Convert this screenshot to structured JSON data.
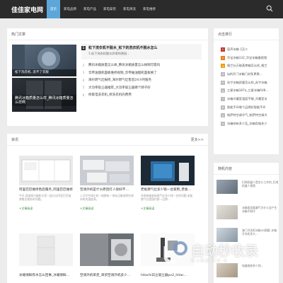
{
  "site": {
    "logo": "佳佳家电网"
  },
  "nav": {
    "items": [
      {
        "label": "首页",
        "active": true
      },
      {
        "label": "家电品牌"
      },
      {
        "label": "家电产品"
      },
      {
        "label": "家电安装"
      },
      {
        "label": "家电清洗"
      },
      {
        "label": "家电维修"
      }
    ]
  },
  "hot": {
    "title": "热门文章",
    "hero1_caption": "松下洗衣机..洗不了衣服",
    "hero2_caption": "腾讯冰箱质量怎么样_腾讯冰箱质量怎么样啊",
    "featured": {
      "num": "1",
      "title": "松下洗衣机不脱水_松下的洗衣机不脱水怎么",
      "desc": "1.松下洗衣机脱水异常的原因..."
    },
    "list": [
      {
        "num": "2",
        "text": "腾讯冰箱质量怎么样_腾讯冰箱质量怎么样啊可靠吗"
      },
      {
        "num": "3",
        "text": "华帝油烟机面板维修视频_华帝抽油烟机面板换了"
      },
      {
        "num": "4",
        "text": "海尔燃气灶报修_海尔燃气灶售后24小时服务"
      },
      {
        "num": "5",
        "text": "大功率吸尘器推荐_大功率吸尘器哪个牌子好"
      },
      {
        "num": "6",
        "text": "修家电洗衣机_修洗衣机的费用"
      }
    ]
  },
  "info": {
    "title": "资讯",
    "more": "更多>>",
    "cards": [
      {
        "title": "阿里巴巴维修售后服务_阿里巴巴维修",
        "desc": "今天,我很高兴能和大家一起讨论阿里巴巴维修售后服务的问题。",
        "tag": "+文章阅读"
      },
      {
        "title": "空调外机是什么原因打人很好不…",
        "desc": "1.打开空调主机一般都有一块标注着说明空调外机的温度表。",
        "tag": "+文章阅读"
      },
      {
        "title": "老板燃气灶多少钱一台家用_老板…",
        "desc": "非常感谢老板燃气灶多少钱一台的问题,老板燃气灶是国内第一品牌…",
        "tag": "+文章阅读"
      },
      {
        "title": "冰箱保鲜有水怎么回事_冰箱保鲜…",
        "desc": "",
        "tag": ""
      },
      {
        "title": "空调外机单走_单买空调外机多少…",
        "desc": "",
        "tag": ""
      },
      {
        "title": "hitachi日立吸尘器pv2_hitac…",
        "desc": "",
        "tag": ""
      }
    ]
  },
  "rank": {
    "title": "点击排行",
    "items": [
      {
        "num": "1",
        "text": "容声冰箱【买二"
      },
      {
        "num": "2",
        "text": "华宝冰箱132_华宝冰箱看视频"
      },
      {
        "num": "3",
        "text": "格兰仕万能蒸烤箱怎么样_格兰"
      },
      {
        "num": "4",
        "text": "lg的开门冰箱门封条更换…"
      },
      {
        "num": "5",
        "text": "苏宁冰箱质量怎么样_苏宁冰箱"
      },
      {
        "num": "6",
        "text": "三星冰箱187a_三星冰箱R48…"
      },
      {
        "num": "7",
        "text": "冰箱冷藏室温度不够_冷藏室冰"
      },
      {
        "num": "8",
        "text": "智能手环哪个品牌好智能手环"
      },
      {
        "num": "9",
        "text": "帕萨特空调冷气_帕萨特空调冷"
      },
      {
        "num": "10",
        "text": "冰箱响有多少瓦_冰箱用电多少"
      }
    ]
  },
  "random": {
    "title": "随机内容",
    "items": [
      {
        "text": "扫地机器人是怎么工作的_扫地机器人视频"
      },
      {
        "text": "冰箱蒸发器漏气为什么会产生冰箱不制冷"
      },
      {
        "text": "澳门冷冻柜冰箱3D图解_冰箱冷冻柜多大…"
      },
      {
        "text": "电器维修多少钱…"
      }
    ]
  },
  "watermark": {
    "text": "自动秒收录",
    "sub": "数 上 精 选 · 来 访 · 友"
  },
  "colors": {
    "accent": "#5ca7d8",
    "nav_bg": "#2b2b2b",
    "rank_top": [
      "#c0392b",
      "#e67e22",
      "#f39c12"
    ]
  }
}
